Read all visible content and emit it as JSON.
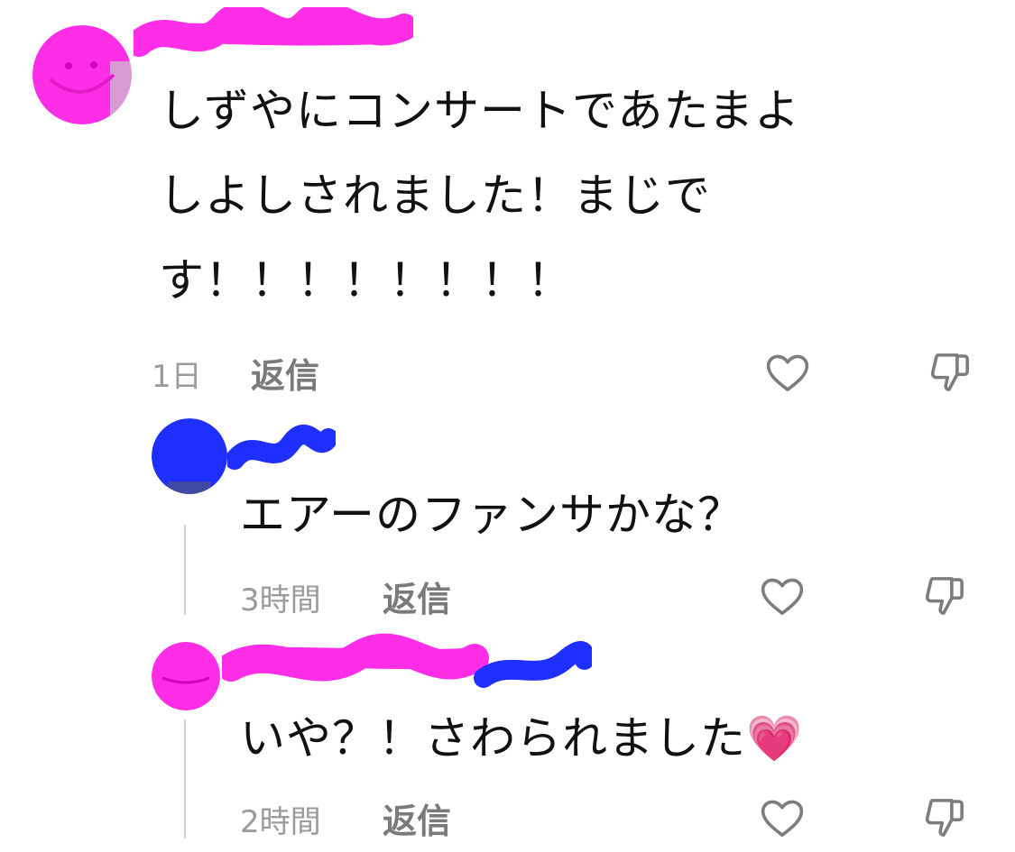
{
  "comments": [
    {
      "text_lines": [
        "しずやにコンサートであたまよ",
        "しよしされました！まじで",
        "す！！！！！！！！"
      ],
      "time": "1日",
      "reply_label": "返信",
      "avatar_color": "#ff2ee6"
    },
    {
      "text_lines": [
        "エアーのファンサかな？"
      ],
      "time": "3時間",
      "reply_label": "返信",
      "avatar_color": "#1e2fff"
    },
    {
      "text_lines": [
        "いや？！さわられました"
      ],
      "emoji": "💗",
      "time": "2時間",
      "reply_label": "返信",
      "avatar_color": "#ff2ee6"
    }
  ],
  "colors": {
    "redaction_pink": "#ff2ee6",
    "redaction_blue": "#1e2fff",
    "meta_gray": "#9b9b9b",
    "reply_gray": "#7a7a7a",
    "icon_gray": "#7d7d7d"
  },
  "icons": [
    "heart-outline-icon",
    "thumbs-down-outline-icon",
    "growing-heart-emoji"
  ]
}
